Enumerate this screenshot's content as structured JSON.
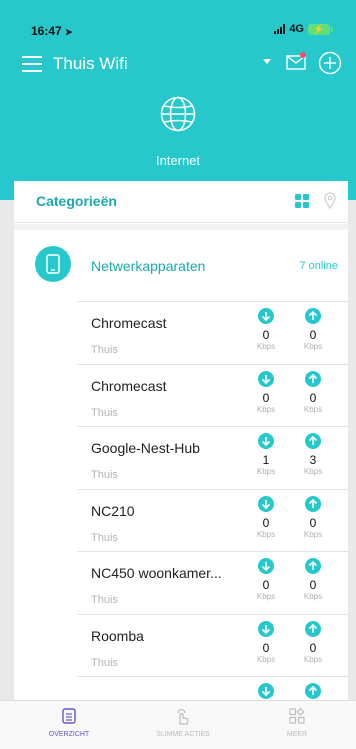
{
  "status_bar": {
    "time": "16:47",
    "network": "4G"
  },
  "nav": {
    "title": "Thuis Wifi"
  },
  "internet": {
    "label": "Internet"
  },
  "categories": {
    "title": "Categorieën"
  },
  "group": {
    "title": "Netwerkapparaten",
    "count": "7 online"
  },
  "devices": [
    {
      "name": "Chromecast",
      "location": "Thuis",
      "down": "0",
      "up": "0",
      "unit": "Kbps"
    },
    {
      "name": "Chromecast",
      "location": "Thuis",
      "down": "0",
      "up": "0",
      "unit": "Kbps"
    },
    {
      "name": "Google-Nest-Hub",
      "location": "Thuis",
      "down": "1",
      "up": "3",
      "unit": "Kbps"
    },
    {
      "name": "NC210",
      "location": "Thuis",
      "down": "0",
      "up": "0",
      "unit": "Kbps"
    },
    {
      "name": "NC450 woonkamer...",
      "location": "Thuis",
      "down": "0",
      "up": "0",
      "unit": "Kbps"
    },
    {
      "name": "Roomba",
      "location": "Thuis",
      "down": "0",
      "up": "0",
      "unit": "Kbps"
    }
  ],
  "tabs": [
    {
      "label": "OVERZICHT"
    },
    {
      "label": "SLIMME ACTIES"
    },
    {
      "label": "MEER"
    }
  ],
  "colors": {
    "brand": "#27c8cc",
    "accent": "#1aa9b0",
    "tab_active": "#6b55c9"
  }
}
